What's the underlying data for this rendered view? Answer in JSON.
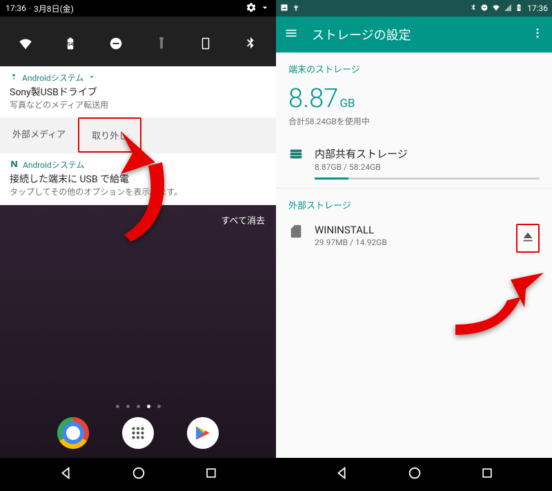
{
  "left": {
    "status": {
      "time": "17:36",
      "date": "3月8日(金)"
    },
    "notif1": {
      "app": "Androidシステム",
      "title": "Sony製USBドライブ",
      "sub": "写真などのメディア転送用",
      "action_media": "外部メディア",
      "action_eject": "取り外し"
    },
    "notif2": {
      "app": "Androidシステム",
      "title": "接続した端末に USB で給電",
      "sub": "タップしてその他のオプションを表示します。"
    },
    "clear_all": "すべて消去"
  },
  "right": {
    "status": {
      "time": "17:36",
      "battery": "94"
    },
    "appbar_title": "ストレージの設定",
    "section_device": "端末のストレージ",
    "used_value": "8.87",
    "used_unit": "GB",
    "total_line": "合計58.24GBを使用中",
    "internal": {
      "name": "内部共有ストレージ",
      "detail": "8.87GB / 58.24GB",
      "progress_percent": 15
    },
    "section_external": "外部ストレージ",
    "external": {
      "name": "WININSTALL",
      "detail": "29.97MB / 14.92GB"
    }
  }
}
